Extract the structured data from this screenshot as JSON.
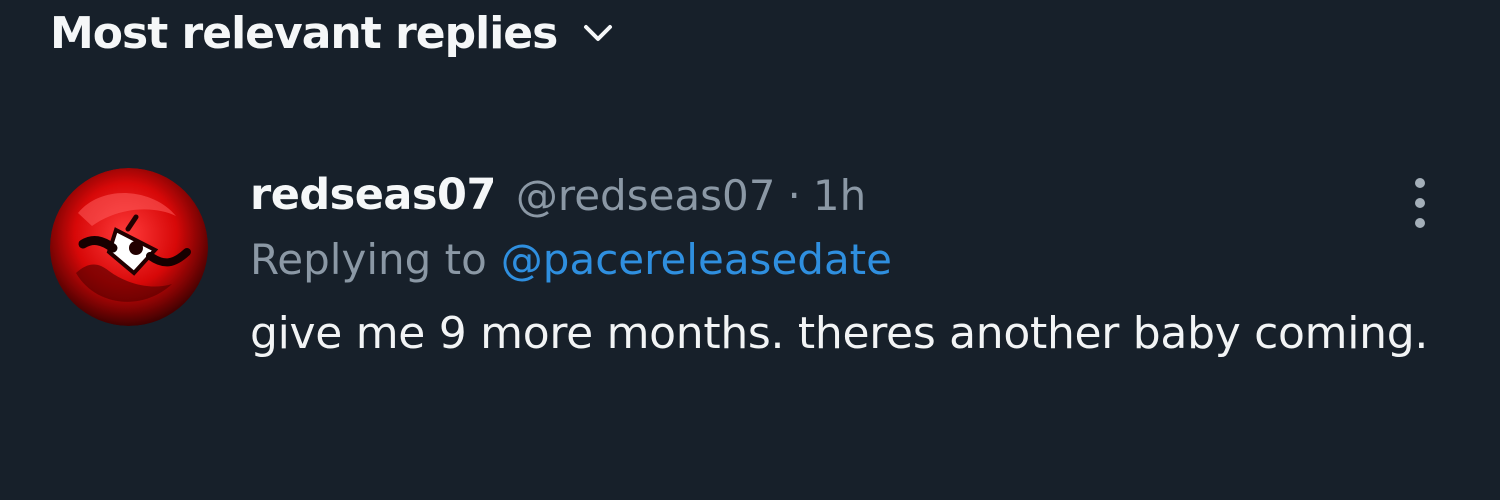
{
  "sort": {
    "label": "Most relevant replies",
    "icon": "chevron-down-icon"
  },
  "reply": {
    "display_name": "redseas07",
    "handle": "@redseas07",
    "separator": "·",
    "time": "1h",
    "replying_prefix": "Replying to",
    "replying_to": "@pacereleasedate",
    "text": "give me 9 more months. theres another baby coming.",
    "avatar_icon": "avatar-red-circle",
    "more_icon": "more-vertical-icon"
  },
  "colors": {
    "background": "#17202a",
    "primary_text": "#f5f7f8",
    "secondary_text": "#8b98a5",
    "link": "#2f8fdf",
    "avatar_red": "#d30a0a"
  }
}
